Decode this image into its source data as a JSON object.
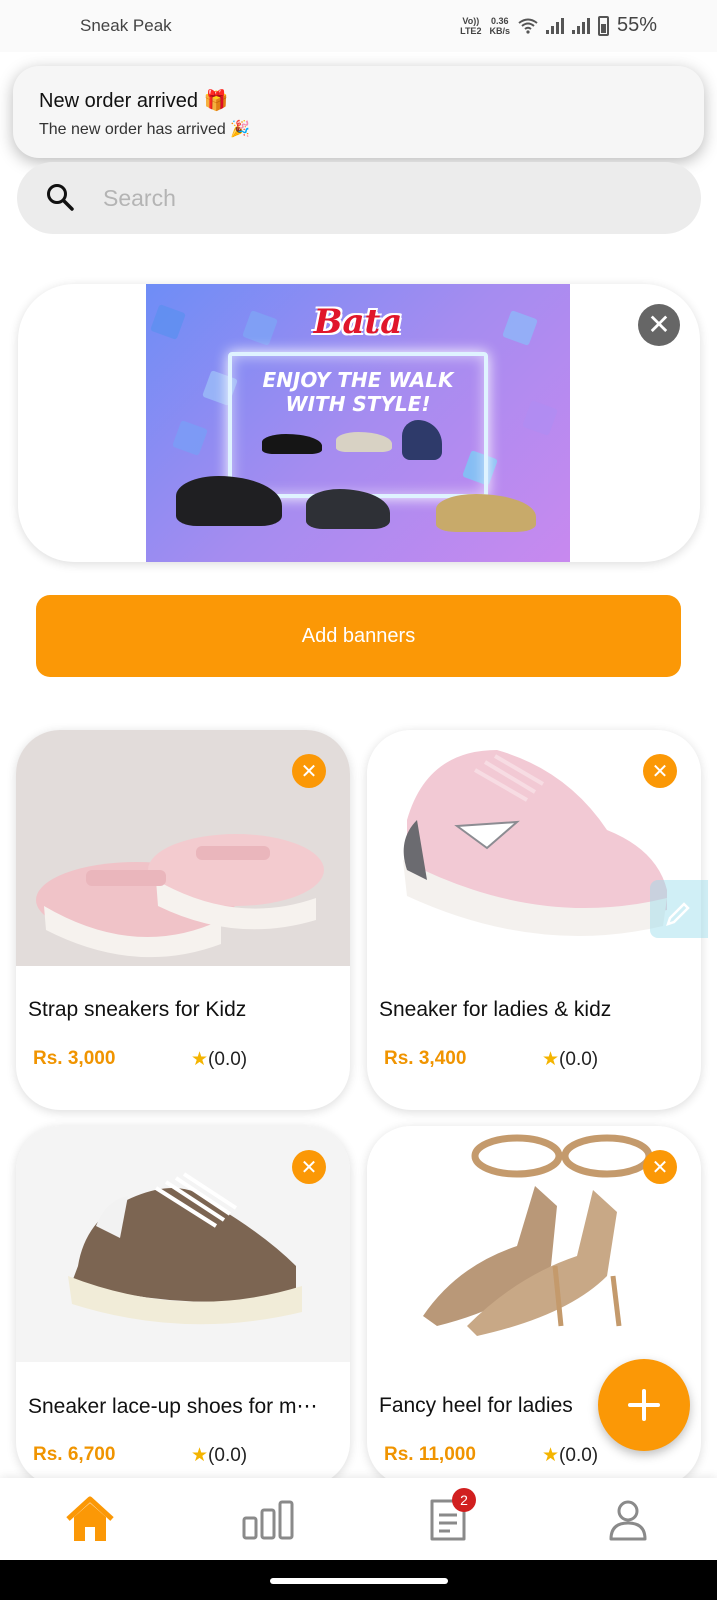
{
  "status_bar": {
    "app_name": "Sneak Peak",
    "net_top": "Vo))",
    "net_bottom": "LTE2",
    "speed_value": "0.36",
    "speed_unit": "KB/s",
    "battery": "55%"
  },
  "notification": {
    "title": "New order arrived 🎁",
    "body": "The new order has arrived 🎉"
  },
  "search": {
    "placeholder": "Search",
    "value": ""
  },
  "banner": {
    "brand": "Bata",
    "tagline_1": "ENJOY THE WALK",
    "tagline_2": "WITH STYLE!",
    "close_symbol": "✕"
  },
  "add_banners_label": "Add banners",
  "products": [
    {
      "name": "Strap sneakers for Kidz",
      "price": "Rs. 3,000",
      "rating": "(0.0)"
    },
    {
      "name": "Sneaker for ladies & kidz",
      "price": "Rs. 3,400",
      "rating": "(0.0)"
    },
    {
      "name": "Sneaker lace-up shoes for m⋯",
      "price": "Rs. 6,700",
      "rating": "(0.0)"
    },
    {
      "name": "Fancy heel for ladies",
      "price": "Rs. 11,000",
      "rating": "(0.0)"
    }
  ],
  "star_symbol": "★",
  "remove_symbol": "✕",
  "bottom_nav": {
    "items": [
      "home-icon",
      "stats-icon",
      "orders-icon",
      "profile-icon"
    ],
    "orders_badge": "2",
    "active_color": "#fb9806",
    "inactive_color": "#8a8a8a"
  },
  "colors": {
    "accent": "#fb9806",
    "price": "#f09400",
    "badge": "#d11f1f"
  }
}
